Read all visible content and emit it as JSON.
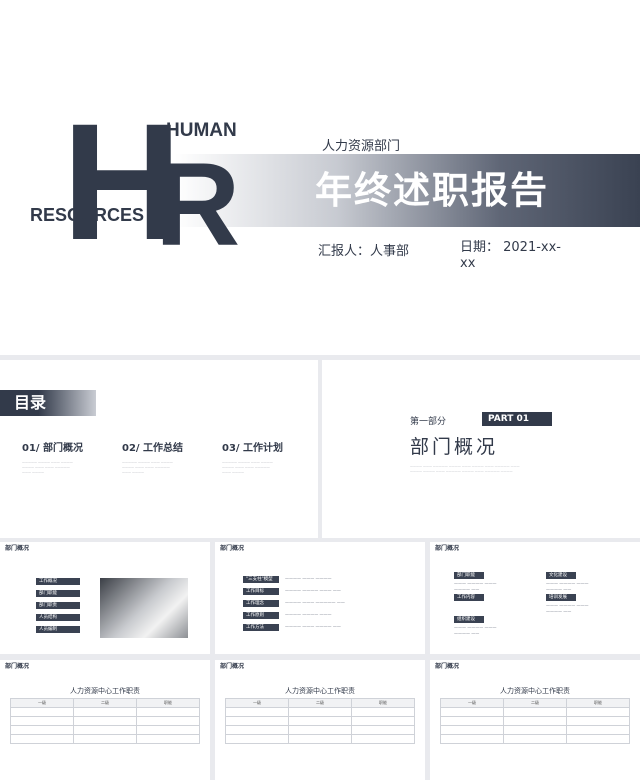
{
  "hero": {
    "letter_h": "H",
    "letter_r": "R",
    "human": "HUMAN",
    "resources": "RESOURCES",
    "department": "人力资源部门",
    "title": "年终述职报告",
    "reporter": "汇报人：人事部",
    "date": "日期： 2021-xx-xx"
  },
  "toc": {
    "heading": "目录",
    "items": [
      {
        "label": "01/ 部门概况"
      },
      {
        "label": "02/ 工作总结"
      },
      {
        "label": "03/ 工作计划"
      }
    ]
  },
  "part": {
    "label": "第一部分",
    "badge": "PART 01",
    "title": "部门概况"
  },
  "thumbs": {
    "header": "部门概况",
    "slide1_items": [
      "工作概况",
      "部门职能",
      "部门职责",
      "人员结构",
      "人员编制"
    ],
    "slide2_items": [
      "\"三支柱\"模型",
      "工作目标",
      "工作理念",
      "工作原则",
      "工作方法"
    ],
    "slide3_items": [
      "部门职能",
      "工作内容",
      "组织建设",
      "文化建设",
      "培训发展"
    ],
    "table_title": "人力资源中心工作职责",
    "table_headers": [
      "一级",
      "二级",
      "职能"
    ]
  }
}
